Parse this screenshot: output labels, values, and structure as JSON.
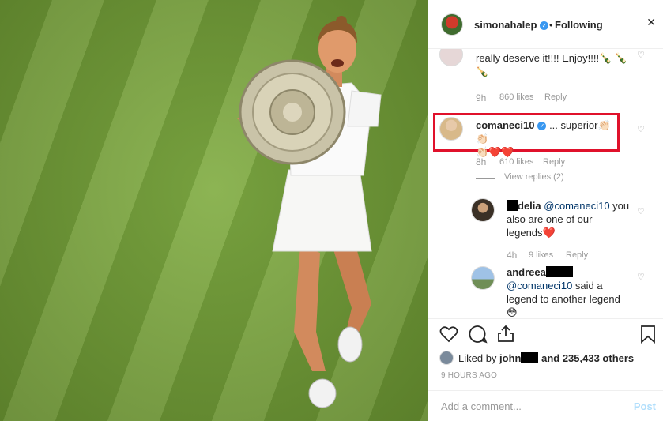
{
  "header": {
    "username": "simonahalep",
    "verified_icon": "verified-check",
    "separator": "•",
    "follow_status": "Following"
  },
  "comments": [
    {
      "text_line1": "really deserve it!!!! Enjoy!!!!🍾 🍾",
      "text_line2": "🍾",
      "time": "9h",
      "likes": "860 likes",
      "reply": "Reply"
    },
    {
      "username": "comaneci10",
      "text": "... superior👏🏻👏🏻",
      "text_line2": "👏🏻❤️❤️",
      "time": "8h",
      "likes": "610 likes",
      "reply": "Reply",
      "view_replies": "View replies (2)"
    },
    {
      "username_suffix": "delia",
      "mention": "@comaneci10",
      "text": " you",
      "text_line2": "also are one of our",
      "text_line3": "legends❤️",
      "time": "4h",
      "likes": "9 likes",
      "reply": "Reply"
    },
    {
      "username": "andreea",
      "mention": "@comaneci10",
      "text": " said a",
      "text_line2": "legend to another legend",
      "text_line3": "😳"
    }
  ],
  "actions": {
    "liked_by_prefix": "Liked by ",
    "liked_by_user": "john",
    "liked_by_suffix": " and 235,433 others",
    "time_ago": "9 HOURS AGO",
    "add_comment_placeholder": "Add a comment...",
    "post_label": "Post"
  },
  "colors": {
    "verified": "#3897f0",
    "highlight": "#e0112b",
    "post_disabled": "#b2dffc",
    "muted": "#999999"
  }
}
